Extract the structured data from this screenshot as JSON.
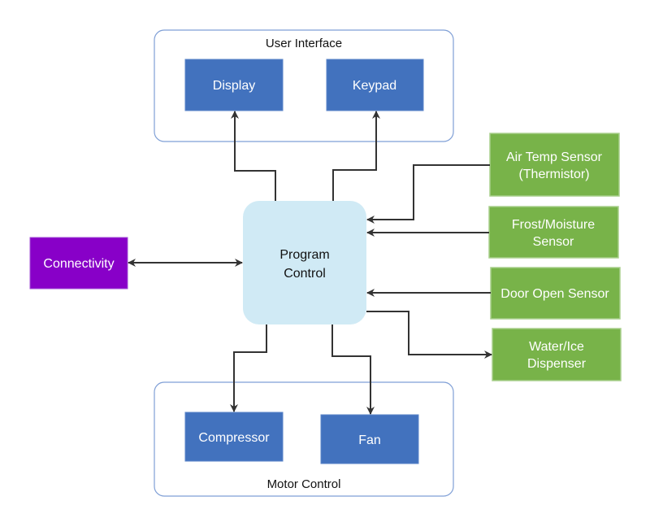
{
  "groups": {
    "user_interface": {
      "label": "User Interface",
      "items": {
        "display": "Display",
        "keypad": "Keypad"
      }
    },
    "motor_control": {
      "label": "Motor Control",
      "items": {
        "compressor": "Compressor",
        "fan": "Fan"
      }
    }
  },
  "core": {
    "line1": "Program",
    "line2": "Control"
  },
  "connectivity": "Connectivity",
  "sensors": {
    "air_temp": {
      "line1": "Air Temp Sensor",
      "line2": "(Thermistor)"
    },
    "frost": {
      "line1": "Frost/Moisture",
      "line2": "Sensor"
    },
    "door": {
      "line1": "Door Open Sensor"
    },
    "water": {
      "line1": "Water/Ice",
      "line2": "Dispenser"
    }
  },
  "colors": {
    "blue_block": "#4272be",
    "green_block": "#78b349",
    "purple_block": "#8800c8",
    "core": "#d0eaf5",
    "group_border": "#7f9fd6"
  }
}
